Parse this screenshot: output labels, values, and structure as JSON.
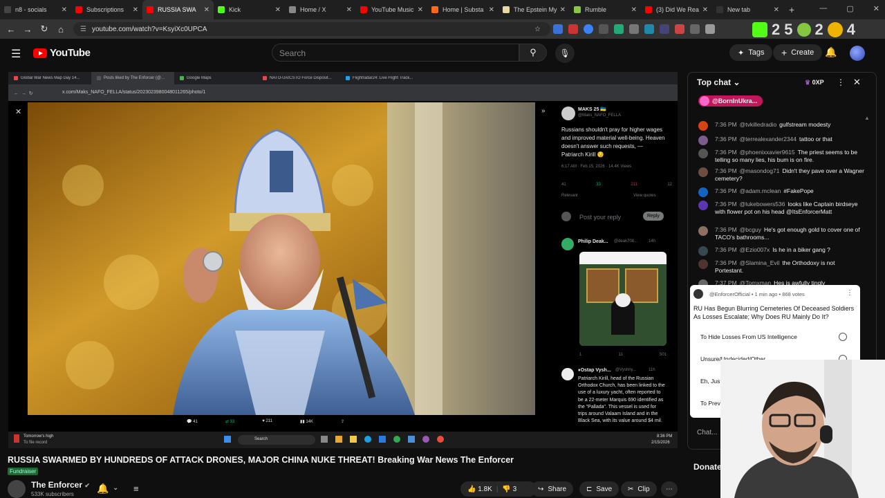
{
  "browser": {
    "tabs": [
      {
        "title": "n8 - socials",
        "color": "#444"
      },
      {
        "title": "Subscriptions",
        "color": "#ff0000"
      },
      {
        "title": "RUSSIA SWA",
        "color": "#ff0000",
        "active": true
      },
      {
        "title": "Kick",
        "color": "#53fc18"
      },
      {
        "title": "Home / X",
        "color": "#888"
      },
      {
        "title": "YouTube Music",
        "color": "#ff0000"
      },
      {
        "title": "Home | Substa",
        "color": "#ff6719"
      },
      {
        "title": "The Epstein My",
        "color": "#e8d9a0"
      },
      {
        "title": "Rumble",
        "color": "#85c742"
      },
      {
        "title": "(3) Did We Rea",
        "color": "#ff0000"
      },
      {
        "title": "New tab",
        "color": "#333"
      }
    ],
    "new_tab": "+",
    "url": "youtube.com/watch?v=KsyiXc0UPCA",
    "big_digits": [
      "2",
      "5",
      "2",
      "4"
    ]
  },
  "youtube": {
    "logo_text": "YouTube",
    "search_placeholder": "Search",
    "tags_label": "Tags",
    "create_label": "Create"
  },
  "inner_browser": {
    "tabs": [
      "Global War News Map Day 14...",
      "Posts liked by The Enforcer (@...",
      "Google Maps",
      "NATO-UA/CSTO Force Disposit...",
      "Flightradar24: Live Flight Track..."
    ],
    "url": "x.com/Maks_NAFO_FELLA/status/2023023980048011265/photo/1",
    "photo_stats": [
      "41",
      "33",
      "211",
      "14K"
    ]
  },
  "tweet": {
    "author": "MAKS 25 🇺🇦",
    "handle": "@Maks_NAFO_FELLA",
    "text": "Russians shouldn't pray for higher wages and improved material well-being. Heaven doesn't answer such requests, — Patriarch Kirill 😏",
    "meta": "6:17 AM · Feb 15, 2026 · 14.4K Views",
    "counts": [
      "41",
      "33",
      "211",
      "12"
    ],
    "relevant": "Relevant",
    "view_quotes": "View quotes",
    "reply_placeholder": "Post your reply",
    "reply_btn": "Reply",
    "reply1_author": "Philip Deak...",
    "reply1_handle": "@deak708...",
    "reply1_time": "14h",
    "reply1_counts": [
      "1",
      "11",
      "501"
    ],
    "reply2_author": "♦Ostap Vysh...",
    "reply2_handle": "@Vyshny...",
    "reply2_time": "11h",
    "reply2_text": "Patriarch Kirill, head of the Russian Orthodox Church, has been linked to the use of a luxury yacht, often reported to be a 22-meter Marquis 690 identified as the \"Pallada\". This vessel is used for trips around Valaam Island and in the Black Sea, with its value around $4 mil."
  },
  "taskbar": {
    "weather": "Tomorrow's high",
    "weather_sub": "To file record",
    "search": "Search",
    "time": "8:36 PM",
    "date": "2/15/2026"
  },
  "video": {
    "title": "RUSSIA SWARMED BY HUNDREDS OF ATTACK DRONES, MAJOR CHINA NUKE THREAT! Breaking War News The Enforcer",
    "fundraiser": "Fundraiser",
    "channel": "The Enforcer",
    "subscribers": "533K subscribers",
    "likes": "1.8K",
    "dislikes": "3",
    "share": "Share",
    "save": "Save",
    "clip": "Clip"
  },
  "chat": {
    "header": "Top chat",
    "points": "0XP",
    "pinned": "@BornInUkra...",
    "messages": [
      {
        "time": "7:36 PM",
        "author": "@tvkilledradio",
        "text": "gulfstream modesty",
        "color": "#d84315"
      },
      {
        "time": "7:36 PM",
        "author": "@terrealexander2344",
        "text": "tattoo or that",
        "color": "#7b5c8a"
      },
      {
        "time": "7:36 PM",
        "author": "@phoenixxavier9615",
        "text": "The priest seems to be telling so many lies, his bum is on fire.",
        "color": "#555"
      },
      {
        "time": "7:36 PM",
        "author": "@masondog71",
        "text": "Didn't they pave over a Wagner cemetery?",
        "color": "#6d4c41"
      },
      {
        "time": "7:36 PM",
        "author": "@adam.mclean",
        "text": "#FakePope",
        "color": "#1565c0"
      },
      {
        "time": "7:36 PM",
        "author": "@lukebowers536",
        "text": "looks like Captain birdseye with flower pot on his head @ItsEnforcerMatt",
        "color": "#5e35b1"
      },
      {
        "time": "7:36 PM",
        "author": "@bcguy",
        "text": "He's got enough gold to cover one of TACO's bathrooms...",
        "color": "#8d6e63"
      },
      {
        "time": "7:36 PM",
        "author": "@Ezio007x",
        "text": "Is he in a biker gang ?",
        "color": "#37474f"
      },
      {
        "time": "7:36 PM",
        "author": "@Slamina_Evil",
        "text": "the Orthodoxy is not Portestant.",
        "color": "#4e342e"
      },
      {
        "time": "7:37 PM",
        "author": "@Tomxman",
        "text": "Hes is awfully tingly",
        "color": "#666"
      }
    ],
    "poll": {
      "meta": "@EnforcerOfficial • 1 min ago • 868 votes",
      "question": "RU Has Begun Blurring Cemeteries Of Deceased Soldiers As Losses Escalate; Why Does RU Mainly Do It?",
      "options": [
        "To Hide Losses From US Intelligence",
        "Unsure/Undecided/Other",
        "Eh, Just",
        "To Prev"
      ]
    },
    "input_placeholder": "Chat...",
    "donate": "Donate"
  },
  "icons": {
    "menu": "hamburger-icon",
    "search": "search-icon",
    "mic": "mic-icon",
    "bell": "bell-icon"
  }
}
